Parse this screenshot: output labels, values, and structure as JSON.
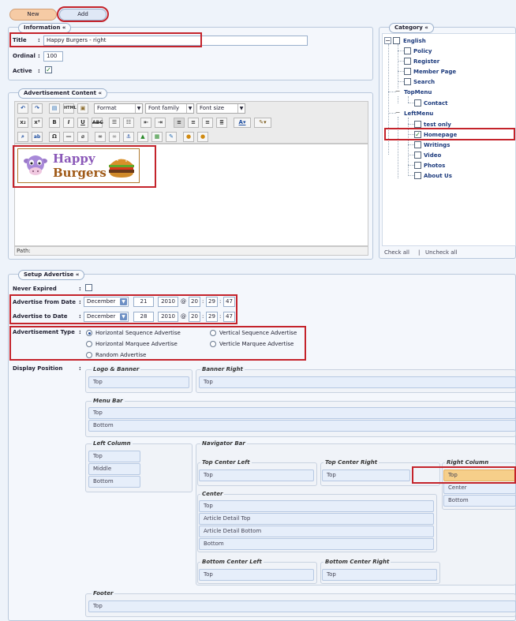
{
  "toolbar": {
    "new_label": "New",
    "add_label": "Add"
  },
  "information": {
    "legend": "Information «",
    "title_label": "Title",
    "title_value": "Happy Burgers - right",
    "ordinal_label": "Ordinal",
    "ordinal_value": "100",
    "active_label": "Active",
    "active_checked": "✓"
  },
  "category": {
    "legend": "Category «",
    "items": [
      "English",
      "Policy",
      "Register",
      "Member Page",
      "Search",
      "TopMenu",
      "Contact",
      "LeftMenu",
      "test only",
      "Homepage",
      "Writings",
      "Video",
      "Photos",
      "About Us"
    ],
    "checked_mark": "✓",
    "check_all": "Check all",
    "separator": "|",
    "uncheck_all": "Uncheck all"
  },
  "ad_content": {
    "legend": "Advertisement Content «",
    "format": "Format",
    "font_family": "Font family",
    "font_size": "Font size",
    "path_label": "Path:",
    "banner_line1": "Happy",
    "banner_line2": "Burgers"
  },
  "setup": {
    "legend": "Setup Advertise «",
    "never_expired_label": "Never Expired",
    "from_label": "Advertise from Date",
    "to_label": "Advertise to Date",
    "from": {
      "month": "December",
      "day": "21",
      "year": "2010",
      "h": "20",
      "m": "29",
      "s": "47"
    },
    "to": {
      "month": "December",
      "day": "28",
      "year": "2010",
      "h": "20",
      "m": "29",
      "s": "47"
    },
    "at": "@",
    "sep": ":",
    "type_label": "Advertisement Type",
    "types": [
      "Horizontal Sequence Advertise",
      "Vertical Sequence Advertise",
      "Horizontal Marquee Advertise",
      "Verticle Marquee Advertise",
      "Random Advertise"
    ],
    "display_label": "Display Position"
  },
  "positions": {
    "logo_banner": "Logo & Banner",
    "banner_right": "Banner Right",
    "menu_bar": "Menu Bar",
    "left_column": "Left Column",
    "navigator_bar": "Navigator Bar",
    "top_center_left": "Top Center Left",
    "top_center_right": "Top Center Right",
    "right_column": "Right Column",
    "center": "Center",
    "bottom_center_left": "Bottom Center Left",
    "bottom_center_right": "Bottom Center Right",
    "footer": "Footer",
    "top": "Top",
    "bottom": "Bottom",
    "middle": "Middle",
    "center_slot": "Center",
    "article_detail_top": "Article Detail Top",
    "article_detail_bottom": "Article Detail Bottom"
  }
}
